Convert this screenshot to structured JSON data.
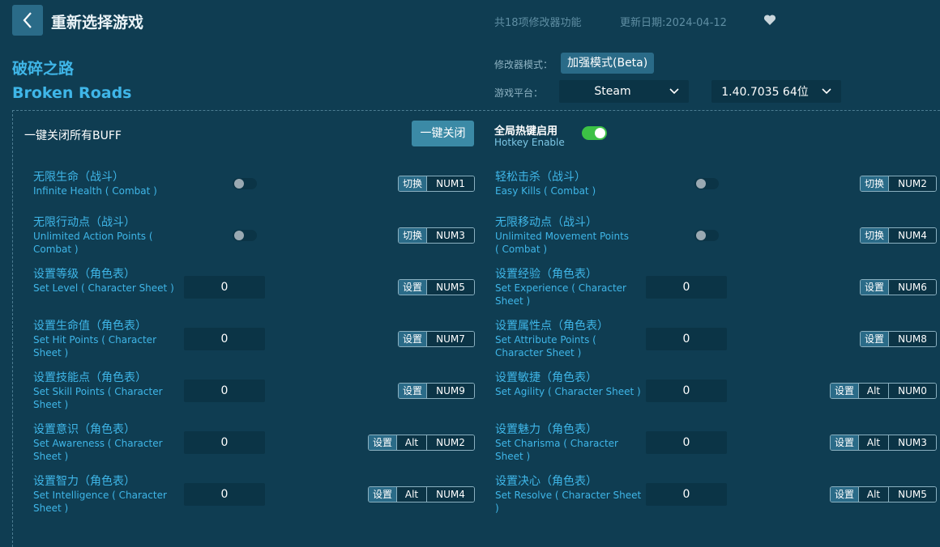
{
  "header": {
    "title": "重新选择游戏",
    "feature_count": "共18项修改器功能",
    "update_date": "更新日期:2024-04-12"
  },
  "game": {
    "name_cn": "破碎之路",
    "name_en": "Broken Roads"
  },
  "mode": {
    "label": "修改器模式：",
    "value": "加强模式(Beta)"
  },
  "platform": {
    "label": "游戏平台：",
    "value": "Steam",
    "version": "1.40.7035 64位"
  },
  "buff": {
    "label": "一键关闭所有BUFF",
    "button": "一键关闭"
  },
  "hotkey_enable": {
    "cn": "全局热键启用",
    "en": "Hotkey Enable",
    "on": true
  },
  "features": [
    {
      "cn": "无限生命（战斗）",
      "en": [
        "Infinite Health ( Combat )"
      ],
      "type": "toggle",
      "action": "切换",
      "keys": [
        "NUM1"
      ]
    },
    {
      "cn": "轻松击杀（战斗）",
      "en": [
        "Easy Kills ( Combat )"
      ],
      "type": "toggle",
      "action": "切换",
      "keys": [
        "NUM2"
      ]
    },
    {
      "cn": "无限行动点（战斗）",
      "en": [
        "Unlimited Action Points (",
        "Combat )"
      ],
      "type": "toggle",
      "action": "切换",
      "keys": [
        "NUM3"
      ]
    },
    {
      "cn": "无限移动点（战斗）",
      "en": [
        "Unlimited Movement Points",
        "( Combat )"
      ],
      "type": "toggle",
      "action": "切换",
      "keys": [
        "NUM4"
      ]
    },
    {
      "cn": "设置等级（角色表）",
      "en": [
        "Set Level ( Character Sheet )"
      ],
      "type": "input",
      "value": "0",
      "action": "设置",
      "keys": [
        "NUM5"
      ]
    },
    {
      "cn": "设置经验（角色表）",
      "en": [
        "Set Experience ( Character",
        "Sheet )"
      ],
      "type": "input",
      "value": "0",
      "action": "设置",
      "keys": [
        "NUM6"
      ]
    },
    {
      "cn": "设置生命值（角色表）",
      "en": [
        "Set Hit Points ( Character",
        "Sheet )"
      ],
      "type": "input",
      "value": "0",
      "action": "设置",
      "keys": [
        "NUM7"
      ]
    },
    {
      "cn": "设置属性点（角色表）",
      "en": [
        "Set Attribute Points (",
        "Character Sheet )"
      ],
      "type": "input",
      "value": "0",
      "action": "设置",
      "keys": [
        "NUM8"
      ]
    },
    {
      "cn": "设置技能点（角色表）",
      "en": [
        "Set Skill Points ( Character",
        "Sheet )"
      ],
      "type": "input",
      "value": "0",
      "action": "设置",
      "keys": [
        "NUM9"
      ]
    },
    {
      "cn": "设置敏捷（角色表）",
      "en": [
        "Set Agility ( Character Sheet )"
      ],
      "type": "input",
      "value": "0",
      "action": "设置",
      "keys": [
        "Alt",
        "NUM0"
      ]
    },
    {
      "cn": "设置意识（角色表）",
      "en": [
        "Set Awareness ( Character",
        "Sheet )"
      ],
      "type": "input",
      "value": "0",
      "action": "设置",
      "keys": [
        "Alt",
        "NUM2"
      ]
    },
    {
      "cn": "设置魅力（角色表）",
      "en": [
        "Set Charisma ( Character",
        "Sheet )"
      ],
      "type": "input",
      "value": "0",
      "action": "设置",
      "keys": [
        "Alt",
        "NUM3"
      ]
    },
    {
      "cn": "设置智力（角色表）",
      "en": [
        "Set Intelligence ( Character",
        "Sheet )"
      ],
      "type": "input",
      "value": "0",
      "action": "设置",
      "keys": [
        "Alt",
        "NUM4"
      ]
    },
    {
      "cn": "设置决心（角色表）",
      "en": [
        "Set Resolve ( Character Sheet",
        ")"
      ],
      "type": "input",
      "value": "0",
      "action": "设置",
      "keys": [
        "Alt",
        "NUM5"
      ]
    }
  ]
}
